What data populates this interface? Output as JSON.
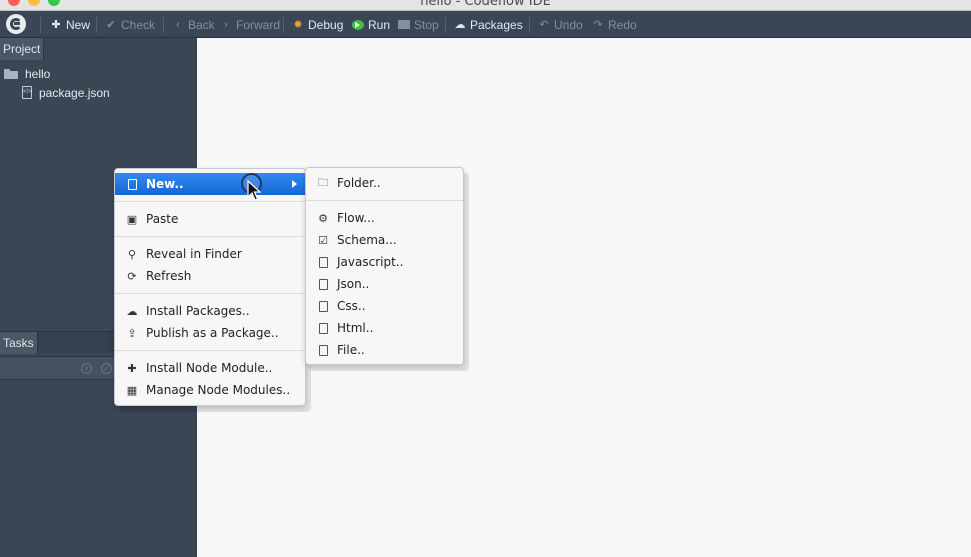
{
  "window": {
    "title": "hello - Codeflow IDE"
  },
  "toolbar": {
    "new": {
      "label": "New",
      "icon": "plus-icon"
    },
    "check": {
      "label": "Check",
      "icon": "check-icon"
    },
    "back": {
      "label": "Back",
      "icon": "chevron-left-icon"
    },
    "forward": {
      "label": "Forward",
      "icon": "chevron-right-icon"
    },
    "debug": {
      "label": "Debug",
      "icon": "bug-icon"
    },
    "run": {
      "label": "Run",
      "icon": "play-circle-icon"
    },
    "stop": {
      "label": "Stop",
      "icon": "stop-icon"
    },
    "packages": {
      "label": "Packages",
      "icon": "cloud-icon"
    },
    "undo": {
      "label": "Undo",
      "icon": "undo-icon"
    },
    "redo": {
      "label": "Redo",
      "icon": "redo-icon"
    }
  },
  "sidebar": {
    "project_tab": "Project",
    "tree": [
      {
        "label": "hello",
        "icon": "folder-open-icon"
      },
      {
        "label": "package.json",
        "icon": "file-code-icon"
      }
    ],
    "tasks_tab": "Tasks"
  },
  "context_menu": {
    "items": [
      {
        "label": "New..",
        "icon": "file-icon",
        "active": true,
        "has_submenu": true
      },
      {
        "label": "Paste",
        "icon": "paste-icon"
      },
      {
        "label": "Reveal in Finder",
        "icon": "search-icon"
      },
      {
        "label": "Refresh",
        "icon": "refresh-icon"
      },
      {
        "label": "Install Packages..",
        "icon": "cloud-download-icon"
      },
      {
        "label": "Publish as a Package..",
        "icon": "upload-icon"
      },
      {
        "label": "Install Node Module..",
        "icon": "plus-icon"
      },
      {
        "label": "Manage Node Modules..",
        "icon": "grid-icon"
      }
    ]
  },
  "submenu": {
    "items": [
      {
        "label": "Folder..",
        "icon": "folder-icon"
      },
      {
        "label": "Flow...",
        "icon": "cogs-icon"
      },
      {
        "label": "Schema...",
        "icon": "check-square-icon"
      },
      {
        "label": "Javascript..",
        "icon": "file-code-icon"
      },
      {
        "label": "Json..",
        "icon": "file-icon"
      },
      {
        "label": "Css..",
        "icon": "file-icon"
      },
      {
        "label": "Html..",
        "icon": "file-icon"
      },
      {
        "label": "File..",
        "icon": "file-icon"
      }
    ]
  }
}
